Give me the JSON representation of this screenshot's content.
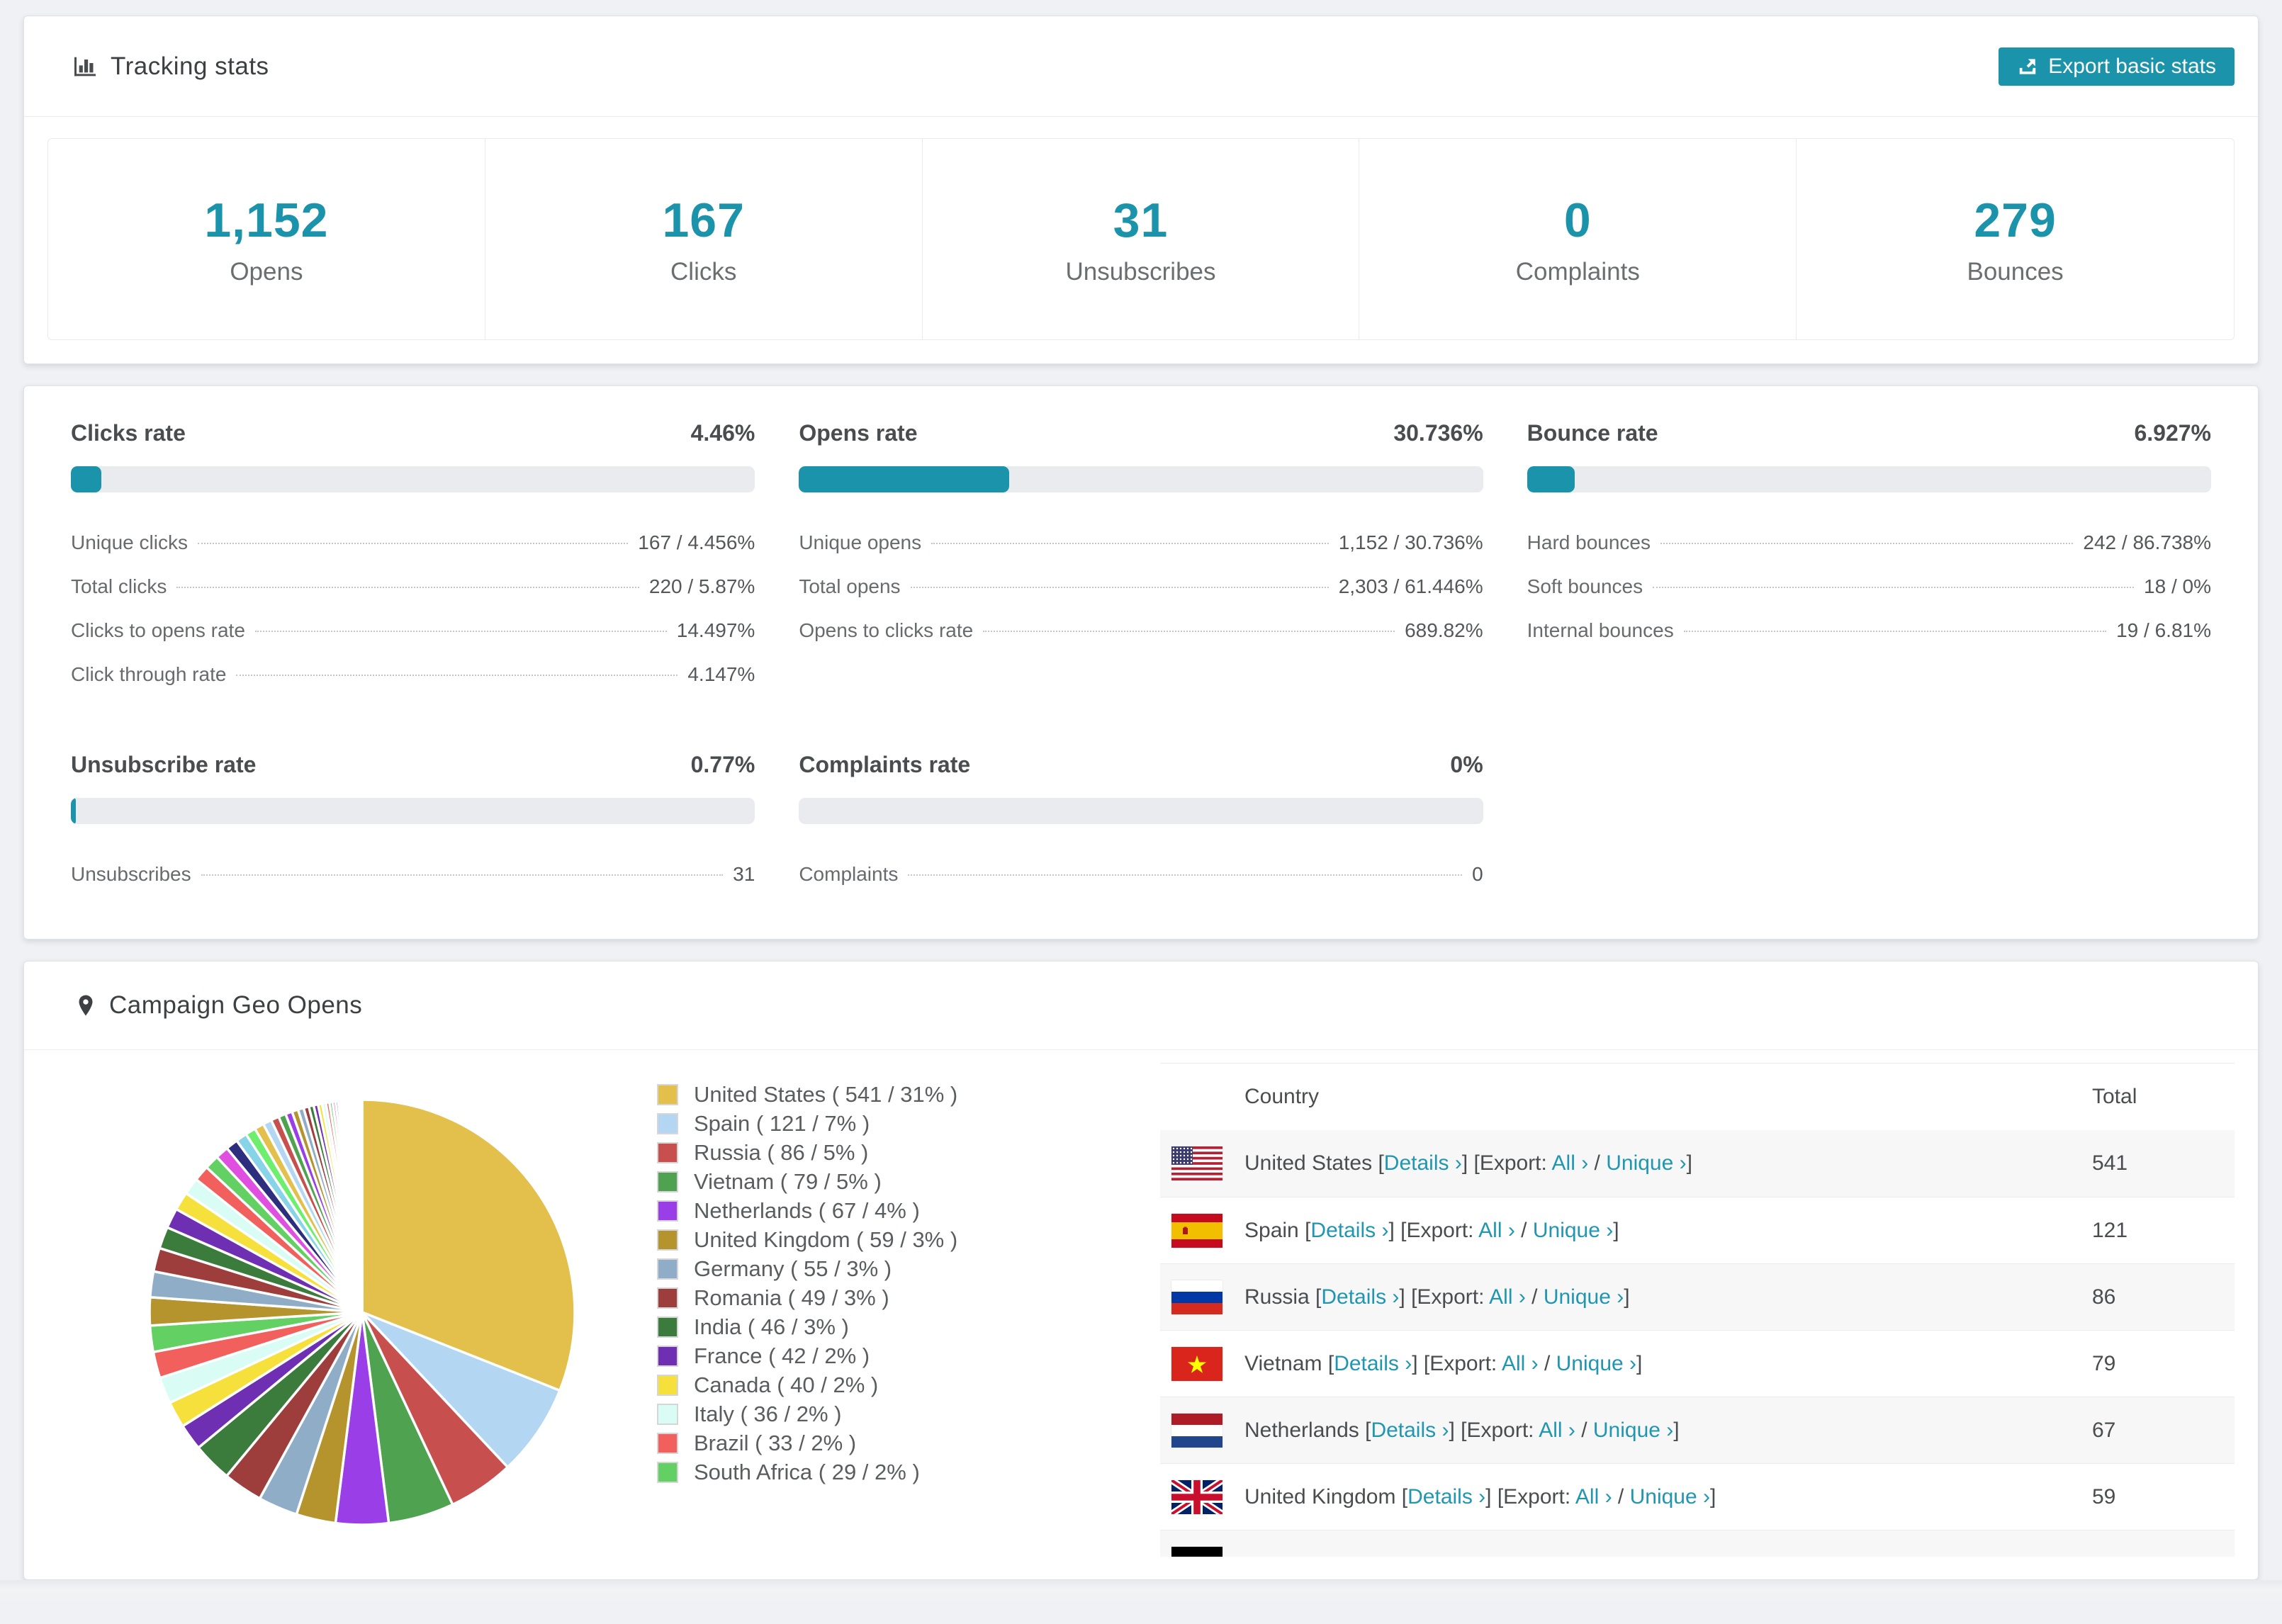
{
  "colors": {
    "accent": "#1b93ab",
    "link": "#2196b0",
    "bar_bg": "#e9ebee",
    "row_alt": "#f7f7f8"
  },
  "tracking": {
    "title": "Tracking stats",
    "export_label": "Export basic stats",
    "stats": [
      {
        "value": "1,152",
        "label": "Opens"
      },
      {
        "value": "167",
        "label": "Clicks"
      },
      {
        "value": "31",
        "label": "Unsubscribes"
      },
      {
        "value": "0",
        "label": "Complaints"
      },
      {
        "value": "279",
        "label": "Bounces"
      }
    ]
  },
  "rates": [
    {
      "title": "Clicks rate",
      "value": "4.46%",
      "pct": 4.46,
      "rows": [
        {
          "label": "Unique clicks",
          "value": "167 / 4.456%"
        },
        {
          "label": "Total clicks",
          "value": "220 / 5.87%"
        },
        {
          "label": "Clicks to opens rate",
          "value": "14.497%"
        },
        {
          "label": "Click through rate",
          "value": "4.147%"
        }
      ]
    },
    {
      "title": "Opens rate",
      "value": "30.736%",
      "pct": 30.736,
      "rows": [
        {
          "label": "Unique opens",
          "value": "1,152 / 30.736%"
        },
        {
          "label": "Total opens",
          "value": "2,303 / 61.446%"
        },
        {
          "label": "Opens to clicks rate",
          "value": "689.82%"
        }
      ]
    },
    {
      "title": "Bounce rate",
      "value": "6.927%",
      "pct": 6.927,
      "rows": [
        {
          "label": "Hard bounces",
          "value": "242 / 86.738%"
        },
        {
          "label": "Soft bounces",
          "value": "18 / 0%"
        },
        {
          "label": "Internal bounces",
          "value": "19 / 6.81%"
        }
      ]
    },
    {
      "title": "Unsubscribe rate",
      "value": "0.77%",
      "pct": 0.77,
      "rows": [
        {
          "label": "Unsubscribes",
          "value": "31"
        }
      ]
    },
    {
      "title": "Complaints rate",
      "value": "0%",
      "pct": 0,
      "rows": [
        {
          "label": "Complaints",
          "value": "0"
        }
      ]
    }
  ],
  "geo": {
    "title": "Campaign Geo Opens",
    "table": {
      "headers": {
        "country": "Country",
        "total": "Total"
      },
      "link_labels": {
        "details": "Details ›",
        "export_prefix": "Export:",
        "all": "All ›",
        "unique": "Unique ›"
      },
      "rows": [
        {
          "flag": "us",
          "country": "United States",
          "total": "541"
        },
        {
          "flag": "es",
          "country": "Spain",
          "total": "121"
        },
        {
          "flag": "ru",
          "country": "Russia",
          "total": "86"
        },
        {
          "flag": "vn",
          "country": "Vietnam",
          "total": "79"
        },
        {
          "flag": "nl",
          "country": "Netherlands",
          "total": "67"
        },
        {
          "flag": "gb",
          "country": "United Kingdom",
          "total": "59"
        },
        {
          "flag": "de",
          "country": "",
          "total": ""
        }
      ]
    },
    "chart_data": {
      "type": "pie",
      "title": "Campaign Geo Opens",
      "legend_position": "right",
      "start_angle_deg": -90,
      "slices": [
        {
          "label": "United States",
          "value": 541,
          "pct": 31,
          "color": "#e3bf4b"
        },
        {
          "label": "Spain",
          "value": 121,
          "pct": 7,
          "color": "#b3d6f2"
        },
        {
          "label": "Russia",
          "value": 86,
          "pct": 5,
          "color": "#c74f4e"
        },
        {
          "label": "Vietnam",
          "value": 79,
          "pct": 5,
          "color": "#4fa24f"
        },
        {
          "label": "Netherlands",
          "value": 67,
          "pct": 4,
          "color": "#9a3fe8"
        },
        {
          "label": "United Kingdom",
          "value": 59,
          "pct": 3,
          "color": "#b5942d"
        },
        {
          "label": "Germany",
          "value": 55,
          "pct": 3,
          "color": "#8fadc6"
        },
        {
          "label": "Romania",
          "value": 49,
          "pct": 3,
          "color": "#9d3d3c"
        },
        {
          "label": "India",
          "value": 46,
          "pct": 3,
          "color": "#3b7b3b"
        },
        {
          "label": "France",
          "value": 42,
          "pct": 2,
          "color": "#6e2fb3"
        },
        {
          "label": "Canada",
          "value": 40,
          "pct": 2,
          "color": "#f6e13c"
        },
        {
          "label": "Italy",
          "value": 36,
          "pct": 2,
          "color": "#d9fcf5"
        },
        {
          "label": "Brazil",
          "value": 33,
          "pct": 2,
          "color": "#f2605d"
        },
        {
          "label": "South Africa",
          "value": 29,
          "pct": 2,
          "color": "#62d062"
        }
      ],
      "other_pct": 26,
      "other_slice_count": 46,
      "legend_format": "{label} ( {value} / {pct}% )"
    }
  }
}
